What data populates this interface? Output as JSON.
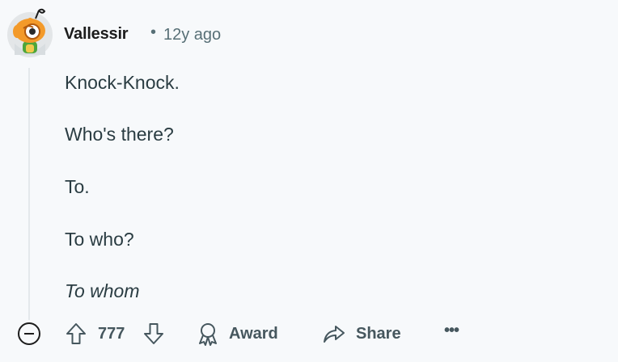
{
  "comment": {
    "author": "Vallessir",
    "separator": "•",
    "age": "12y ago",
    "lines": [
      "Knock-Knock.",
      "Who's there?",
      "To.",
      "To who?",
      "To whom"
    ],
    "avatar_icon": "cartoon-robot-avatar-icon"
  },
  "actions": {
    "vote_count": "777",
    "award_label": "Award",
    "share_label": "Share",
    "more_label": "•••"
  },
  "colors": {
    "background": "#f7f9fb",
    "text": "#2a3c42",
    "muted": "#576f76",
    "action": "#46575e"
  }
}
